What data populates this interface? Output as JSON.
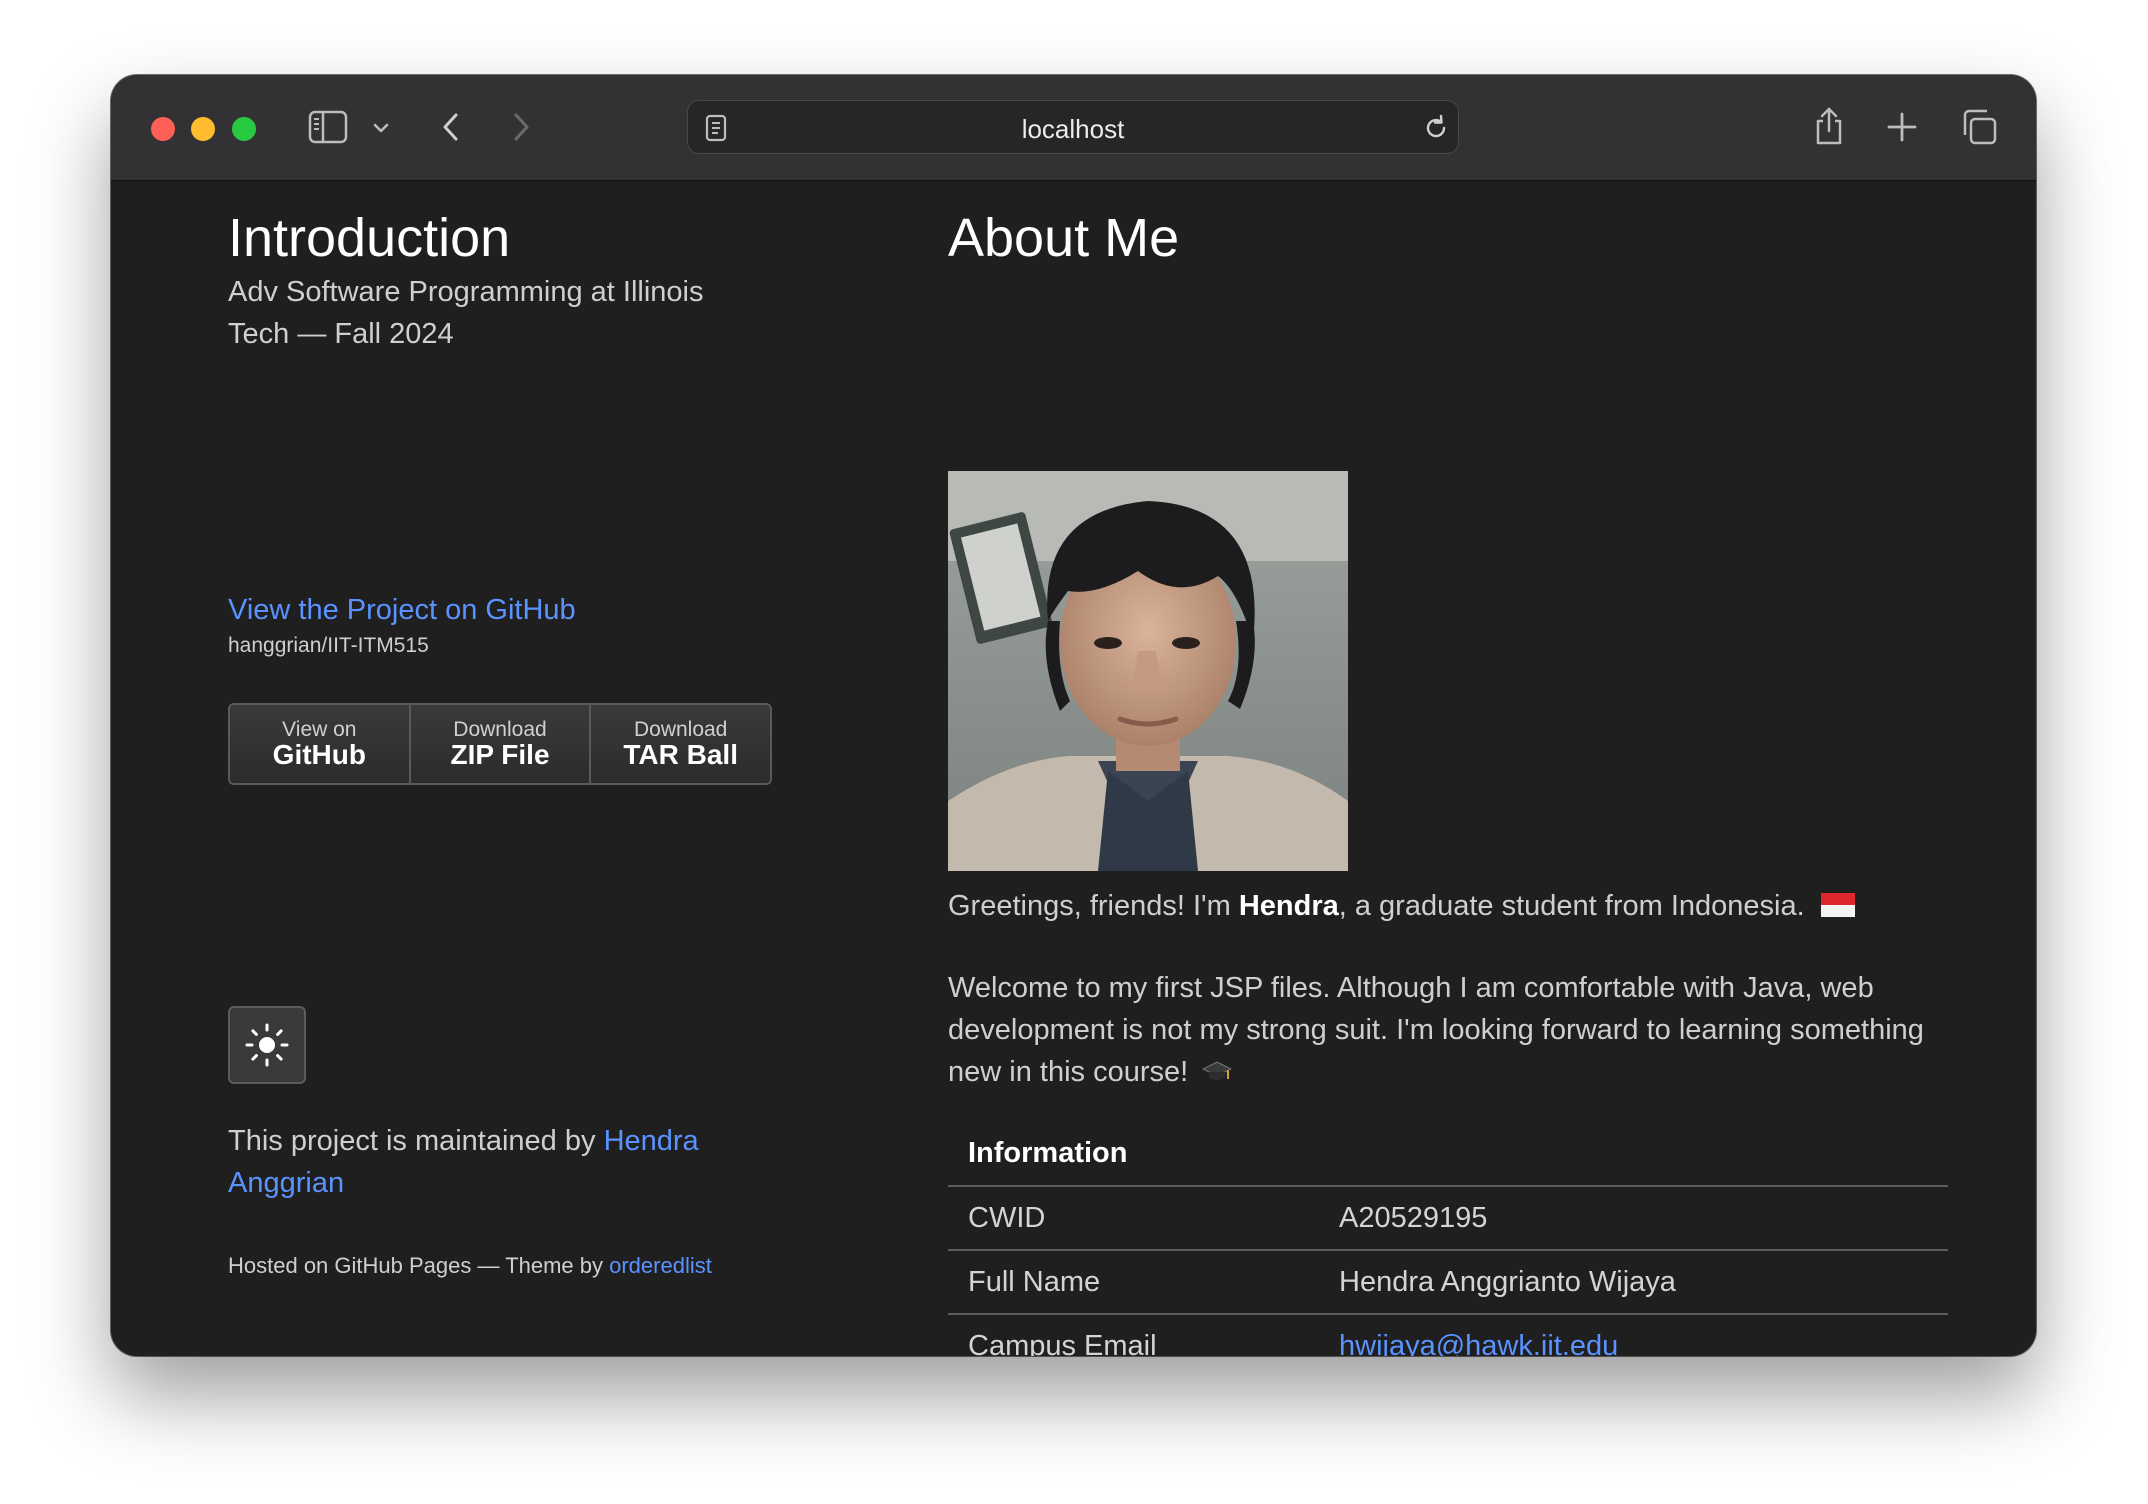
{
  "browser": {
    "address": "localhost"
  },
  "sidebar": {
    "title": "Introduction",
    "tagline": "Adv Software Programming at Illinois Tech — Fall 2024",
    "project_link": "View the Project on GitHub",
    "project_repo": "hanggrian/IIT-ITM515",
    "downloads": [
      {
        "small": "View on",
        "big": "GitHub"
      },
      {
        "small": "Download",
        "big": "ZIP File"
      },
      {
        "small": "Download",
        "big": "TAR Ball"
      }
    ],
    "theme_icon": "sun-icon",
    "maintained_prefix": "This project is maintained by ",
    "maintainer": "Hendra Anggrian",
    "hosted_prefix": "Hosted on GitHub Pages — Theme by ",
    "theme_author": "orderedlist"
  },
  "main": {
    "title": "About Me",
    "greeting_before": "Greetings, friends! I'm ",
    "greeting_name": "Hendra",
    "greeting_after": ", a graduate student from Indonesia.",
    "greeting_emoji": "indonesia-flag-icon",
    "welcome": "Welcome to my first JSP files. Although I am comfortable with Java, web development is not my strong suit. I'm looking forward to learning something new in this course!",
    "welcome_emoji": "graduation-cap-icon",
    "table": {
      "header": "Information",
      "rows": [
        {
          "label": "CWID",
          "value": "A20529195"
        },
        {
          "label": "Full Name",
          "value": "Hendra Anggrianto Wijaya"
        },
        {
          "label": "Campus Email",
          "value": "hwijaya@hawk.iit.edu"
        }
      ]
    }
  },
  "colors": {
    "accent": "#5a93ff",
    "background": "#1f1f1f",
    "toolbar": "#323234"
  }
}
